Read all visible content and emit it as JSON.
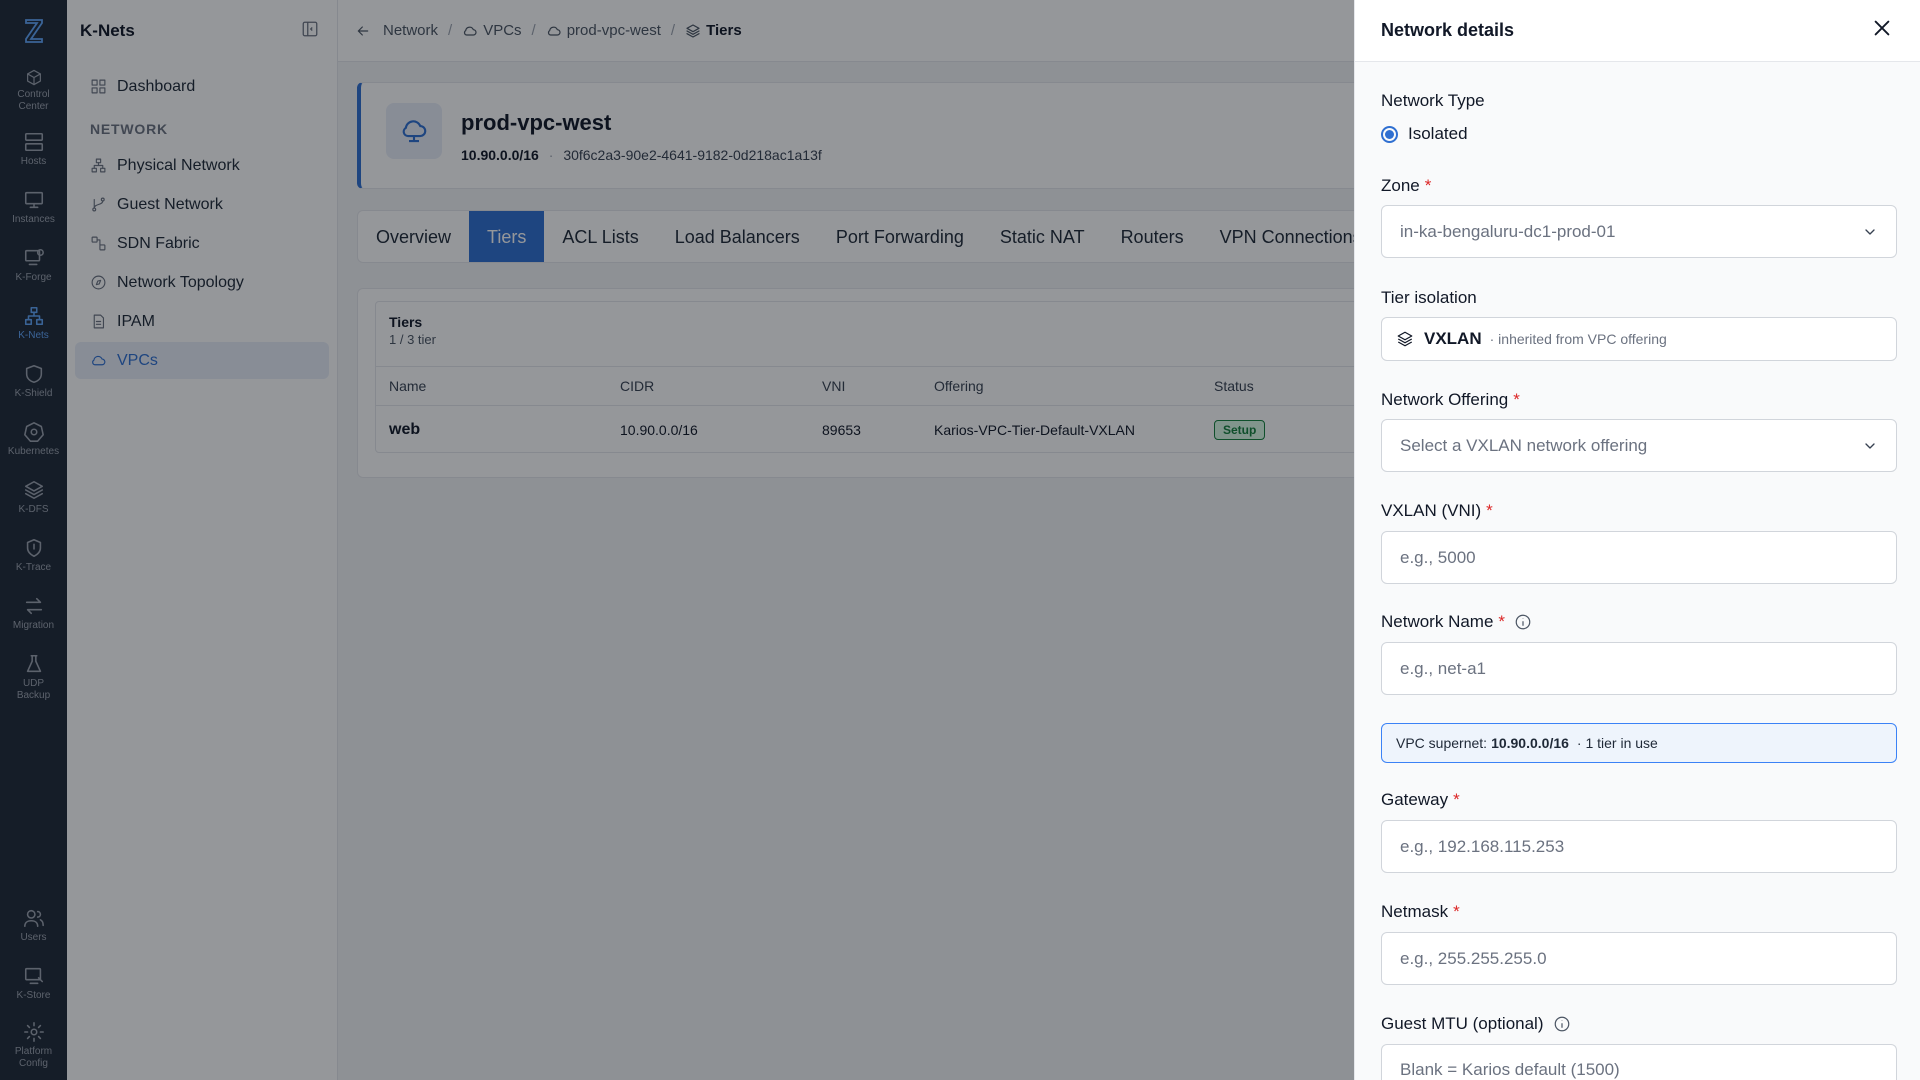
{
  "rail": {
    "items": [
      {
        "label": "Control Center",
        "icon": "cube-icon"
      },
      {
        "label": "Hosts",
        "icon": "server-icon"
      },
      {
        "label": "Instances",
        "icon": "monitor-icon"
      },
      {
        "label": "K-Forge",
        "icon": "forge-icon"
      },
      {
        "label": "K-Nets",
        "icon": "network-icon"
      },
      {
        "label": "K-Shield",
        "icon": "shield-icon"
      },
      {
        "label": "Kubernetes",
        "icon": "kubernetes-icon"
      },
      {
        "label": "K-DFS",
        "icon": "layers-icon"
      },
      {
        "label": "K-Trace",
        "icon": "trace-icon"
      },
      {
        "label": "Migration",
        "icon": "arrows-icon"
      },
      {
        "label": "UDP Backup",
        "icon": "flask-icon"
      }
    ],
    "bottom": [
      {
        "label": "Users",
        "icon": "users-icon"
      },
      {
        "label": "K-Store",
        "icon": "store-icon"
      },
      {
        "label": "Platform Config",
        "icon": "gear-icon"
      }
    ]
  },
  "sidebar": {
    "title": "K-Nets",
    "dashboard": "Dashboard",
    "section": "NETWORK",
    "items": [
      "Physical Network",
      "Guest Network",
      "SDN Fabric",
      "Network Topology",
      "IPAM",
      "VPCs"
    ]
  },
  "breadcrumb": [
    "Network",
    "VPCs",
    "prod-vpc-west",
    "Tiers"
  ],
  "vpc": {
    "name": "prod-vpc-west",
    "cidr": "10.90.0.0/16",
    "dot": "·",
    "id": "30f6c2a3-90e2-4641-9182-0d218ac1a13f"
  },
  "tabs": [
    "Overview",
    "Tiers",
    "ACL Lists",
    "Load Balancers",
    "Port Forwarding",
    "Static NAT",
    "Routers",
    "VPN Connections"
  ],
  "tiers": {
    "title": "Tiers",
    "subtitle": "1 / 3 tier",
    "columns": [
      "Name",
      "CIDR",
      "VNI",
      "Offering",
      "Status"
    ],
    "rows": [
      {
        "name": "web",
        "cidr": "10.90.0.0/16",
        "vni": "89653",
        "offering": "Karios-VPC-Tier-Default-VXLAN",
        "status": "Setup"
      }
    ]
  },
  "drawer": {
    "title": "Network details",
    "network_type_label": "Network Type",
    "network_type_value": "Isolated",
    "zone_label": "Zone",
    "zone_value": "in-ka-bengaluru-dc1-prod-01",
    "tier_isolation_label": "Tier isolation",
    "tier_isolation_value": "VXLAN",
    "tier_isolation_note": "· inherited from VPC offering",
    "offering_label": "Network Offering",
    "offering_placeholder": "Select a VXLAN network offering",
    "vni_label": "VXLAN (VNI)",
    "vni_placeholder": "e.g., 5000",
    "name_label": "Network Name",
    "name_placeholder": "e.g., net-a1",
    "supernet_prefix": "VPC supernet:",
    "supernet_value": "10.90.0.0/16",
    "supernet_suffix": "· 1 tier in use",
    "gateway_label": "Gateway",
    "gateway_placeholder": "e.g., 192.168.115.253",
    "netmask_label": "Netmask",
    "netmask_placeholder": "e.g., 255.255.255.0",
    "mtu_label": "Guest MTU (optional)",
    "mtu_placeholder": "Blank = Karios default (1500)",
    "required_mark": "*"
  },
  "colors": {
    "accent": "#2f6fd1",
    "rail": "#1f2937",
    "required": "#dc2626",
    "status_ok": "#15803d"
  }
}
